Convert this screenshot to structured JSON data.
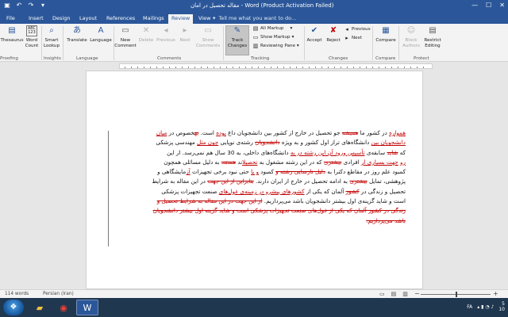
{
  "titlebar": {
    "title": "مقاله تحصیل در امان - Word (Product Activation Failed)",
    "minimize": "—",
    "maximize": "☐",
    "close": "✕"
  },
  "tabs": {
    "file": "File",
    "insert": "Insert",
    "design": "Design",
    "layout": "Layout",
    "references": "References",
    "mailings": "Mailings",
    "review": "Review",
    "view": "View",
    "tellme": "Tell me what you want to do..."
  },
  "ribbon": {
    "thesaurus": "Thesaurus",
    "word_count": "Word Count",
    "word_count_icon_text": "ABC\n123",
    "smart_lookup": "Smart Lookup",
    "translate": "Translate",
    "language": "Language",
    "new_comment": "New Comment",
    "delete": "Delete",
    "previous_c": "Previous",
    "next_c": "Next",
    "show_comments": "Show Comments",
    "track_changes": "Track Changes",
    "all_markup": "All Markup",
    "show_markup": "Show Markup",
    "reviewing_pane": "Reviewing Pane",
    "accept": "Accept",
    "reject": "Reject",
    "previous": "Previous",
    "next": "Next",
    "compare": "Compare",
    "block_authors": "Block Authors",
    "restrict_editing": "Restrict Editing",
    "groups": {
      "proofing": "Proofing",
      "insights": "Insights",
      "language": "Language",
      "comments": "Comments",
      "tracking": "Tracking",
      "changes": "Changes",
      "compare": "Compare",
      "protect": "Protect"
    }
  },
  "document": {
    "lines": [
      [
        {
          "t": "همواره",
          "c": "ins"
        },
        {
          "t": " در کشور ما "
        },
        {
          "t": "همیشه",
          "c": "del"
        },
        {
          "t": " جو تحصیل در خارج از کشور بین دانشجویان داغ "
        },
        {
          "t": "بوده",
          "c": "ins"
        },
        {
          "t": " است. "
        },
        {
          "t": "به",
          "c": "del"
        },
        {
          "t": "خصوص در "
        },
        {
          "t": "میان",
          "c": "ins"
        }
      ],
      [
        {
          "t": "دانشجویان بین",
          "c": "ins"
        },
        {
          "t": " دانشگاه‌های تراز اول کشور و به ویژه "
        },
        {
          "t": "دانشجویان",
          "c": "del"
        },
        {
          "t": " رشته‌ی نوپایی "
        },
        {
          "t": "چون مثل",
          "c": "ins"
        },
        {
          "t": " مهندسی پزشکی"
        }
      ],
      [
        {
          "t": "که "
        },
        {
          "t": "شاید",
          "c": "del"
        },
        {
          "t": " سابقه‌ی "
        },
        {
          "t": "تأسیس ورود آن این رشته در به",
          "c": "ins"
        },
        {
          "t": " دانشگاه‌های داخلی، به 30 سال هم نمی‌رسد. از این"
        }
      ],
      [
        {
          "t": "رو",
          "c": "ins"
        },
        {
          "t": " "
        },
        {
          "t": "جهت بسیاری از",
          "c": "ins"
        },
        {
          "t": " افرادی "
        },
        {
          "t": "بیشتری",
          "c": "del"
        },
        {
          "t": " که در این رشته مشغول به "
        },
        {
          "t": "تحصیل",
          "c": "ins"
        },
        {
          "t": "اند "
        },
        {
          "t": "هستند",
          "c": "del"
        },
        {
          "t": " به دلیل مسائلی همچون"
        }
      ],
      [
        {
          "t": "کمبود علم روز در مقاطع دکترا به "
        },
        {
          "t": "دلیل نارسایی رشته و",
          "c": "del"
        },
        {
          "t": " کمبود "
        },
        {
          "t": "و یا",
          "c": "ins"
        },
        {
          "t": " حتی نبود برخی تجهیزات "
        },
        {
          "t": "آز",
          "c": "ins"
        },
        {
          "t": "مایشگاهی و"
        }
      ],
      [
        {
          "t": "پژوهشی، تمایل "
        },
        {
          "t": "بیشتری",
          "c": "del"
        },
        {
          "t": " به ادامه تحصیل در خارج از ایران دارند. "
        },
        {
          "t": "بنابراین از این جهت",
          "c": "del"
        },
        {
          "t": " در این مقاله به شرایط"
        }
      ],
      [
        {
          "t": "تحصیل و زندگی در "
        },
        {
          "t": "کشور",
          "c": "del"
        },
        {
          "t": " آلمان که یکی از "
        },
        {
          "t": "کشورهای پیشرو در زمینه‌ی غول‌های",
          "c": "ins"
        },
        {
          "t": " صنعت تجهیزات پزشکی"
        }
      ],
      [
        {
          "t": "است و شاید گزینه‌ی اول بیشتر دانشجویان باشد می‌پردازیم. "
        },
        {
          "t": "از این جهت در این مقاله به شرایط تحصیل و",
          "c": "del"
        }
      ],
      [
        {
          "t": "زندگی در کشور آلمان که یکی از غول‌های صنعت تجهیزات پزشکی است و شاید گزینه اول بیشتر دانشجویان",
          "c": "del"
        }
      ],
      [
        {
          "t": "باشد می‌پردازیم.",
          "c": "del"
        }
      ]
    ]
  },
  "status": {
    "words": "114 words",
    "language": "Persian (Iran)",
    "zoom_minus": "−",
    "zoom_plus": "+"
  },
  "taskbar": {
    "lang": "FA",
    "time": "5",
    "date": "10"
  }
}
